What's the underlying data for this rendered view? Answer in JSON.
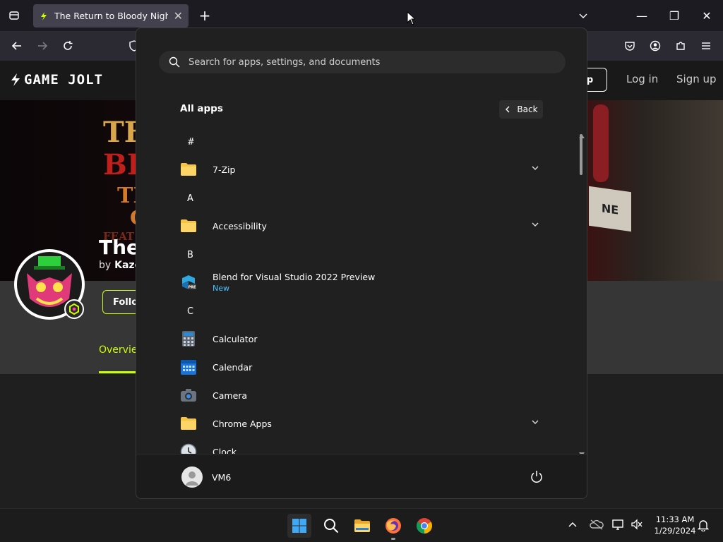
{
  "browser": {
    "tab_title": "The Return to Bloody Nights (C",
    "new_tab": "+",
    "window_minimize": "—",
    "window_restore": "❐",
    "window_close": "✕"
  },
  "site": {
    "logo": "GAME JOLT",
    "app_button": "p",
    "login": "Log in",
    "signup": "Sign up",
    "game_title_fragment": "The",
    "by_fragment": "by",
    "author_fragment": "Kazo",
    "follow_fragment": "Follo",
    "tab_overview": "Overvie",
    "banner_art": {
      "line1": "TH",
      "line2": "BL",
      "line3": "TI",
      "line4": "C",
      "line5": "FEAT",
      "sign": "NE"
    }
  },
  "start_menu": {
    "search_placeholder": "Search for apps, settings, and documents",
    "all_apps_title": "All apps",
    "back_label": "Back",
    "sections": [
      {
        "letter": "#",
        "apps": [
          {
            "name": "7-Zip",
            "icon": "folder-icon",
            "expandable": true
          }
        ]
      },
      {
        "letter": "A",
        "apps": [
          {
            "name": "Accessibility",
            "icon": "folder-icon",
            "expandable": true
          }
        ]
      },
      {
        "letter": "B",
        "apps": [
          {
            "name": "Blend for Visual Studio 2022 Preview",
            "sub": "New",
            "icon": "blend-icon",
            "expandable": false
          }
        ]
      },
      {
        "letter": "C",
        "apps": [
          {
            "name": "Calculator",
            "icon": "calculator-icon",
            "expandable": false
          },
          {
            "name": "Calendar",
            "icon": "calendar-icon",
            "expandable": false
          },
          {
            "name": "Camera",
            "icon": "camera-icon",
            "expandable": false
          },
          {
            "name": "Chrome Apps",
            "icon": "folder-icon",
            "expandable": true
          },
          {
            "name": "Clock",
            "icon": "clock-icon",
            "expandable": false
          }
        ]
      }
    ],
    "user_name": "VM6"
  },
  "taskbar": {
    "time": "11:33 AM",
    "date": "1/29/2024"
  },
  "colors": {
    "accent_blue": "#4cc2ff",
    "folder_yellow": "#f6c343",
    "gamejolt_yellow": "#ccff00"
  }
}
